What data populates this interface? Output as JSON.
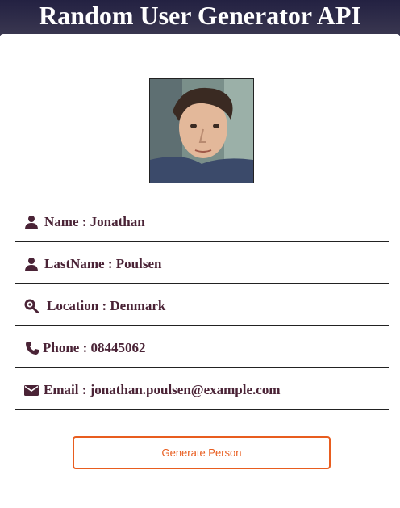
{
  "header": {
    "title": "Random User Generator API"
  },
  "person": {
    "avatar_icon": "user-photo",
    "rows": [
      {
        "icon": "user-icon",
        "text": "Name : Jonathan"
      },
      {
        "icon": "user-icon",
        "text": "LastName : Poulsen"
      },
      {
        "icon": "location-search-icon",
        "text": "Location : Denmark"
      },
      {
        "icon": "phone-icon",
        "text": "Phone : 08445062"
      },
      {
        "icon": "envelope-icon",
        "text": "Email : jonathan.poulsen@example.com"
      }
    ]
  },
  "actions": {
    "generate_label": "Generate Person"
  },
  "colors": {
    "header_bg": "#2d2a45",
    "text": "#4a2336",
    "accent": "#e85d1f"
  }
}
